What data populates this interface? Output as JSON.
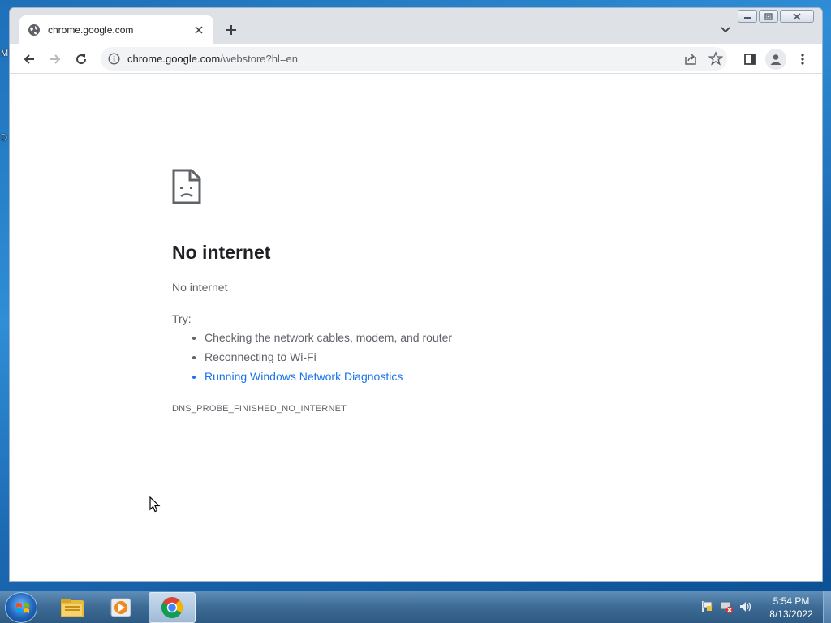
{
  "desktop": {
    "frag_top": "M",
    "frag_mid": "D"
  },
  "window": {
    "tab": {
      "title": "chrome.google.com"
    },
    "omnibox": {
      "host": "chrome.google.com",
      "path": "/webstore?hl=en"
    }
  },
  "page": {
    "title": "No internet",
    "subtitle": "No internet",
    "try_label": "Try:",
    "suggestions": [
      "Checking the network cables, modem, and router",
      "Reconnecting to Wi-Fi",
      "Running Windows Network Diagnostics"
    ],
    "error_code": "DNS_PROBE_FINISHED_NO_INTERNET"
  },
  "taskbar": {
    "clock_time": "5:54 PM",
    "clock_date": "8/13/2022",
    "apps": [
      "windows-explorer",
      "media-player",
      "google-chrome"
    ]
  },
  "colors": {
    "link": "#1a73e8",
    "tabstrip": "#dee1e6",
    "omnibox": "#f1f3f4"
  }
}
